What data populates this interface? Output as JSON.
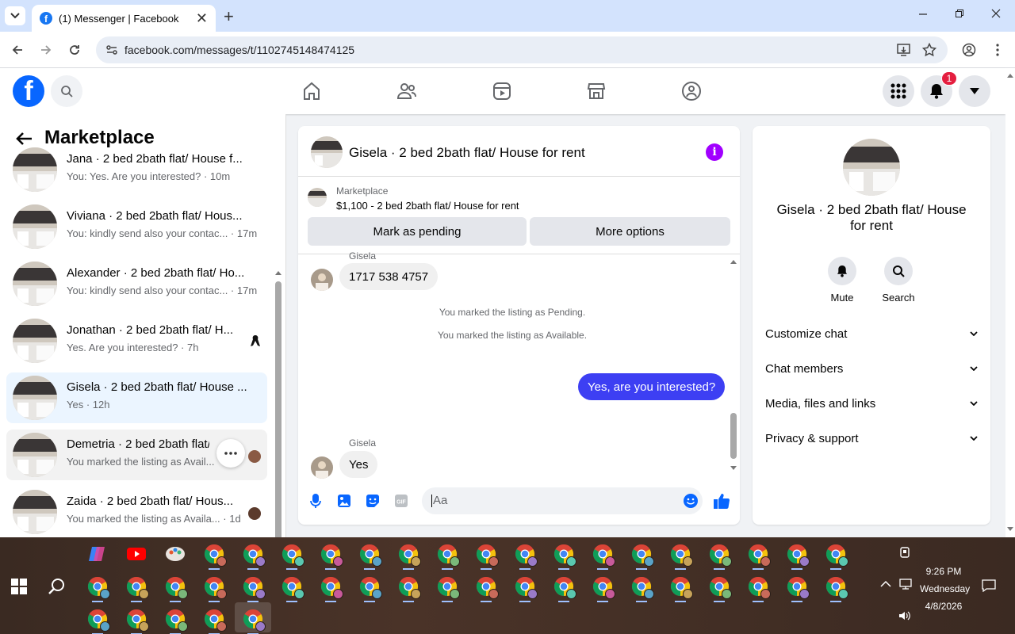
{
  "browser": {
    "tab_title": "(1) Messenger | Facebook",
    "url": "facebook.com/messages/t/1102745148474125",
    "new_tab": "+",
    "close_tab": "✕"
  },
  "fb": {
    "logo_letter": "f",
    "notification_count": "1",
    "nav_icons": [
      "home-icon",
      "friends-icon",
      "video-icon",
      "marketplace-icon",
      "groups-icon"
    ]
  },
  "sidebar": {
    "title": "Marketplace",
    "conversations": [
      {
        "name": "Jana · 2 bed 2bath flat/ House f...",
        "snippet": "You: Yes. Are you interested? · 10m"
      },
      {
        "name": "Viviana · 2 bed 2bath flat/ Hous...",
        "snippet": "You: kindly send also your contac... · 17m"
      },
      {
        "name": "Alexander · 2 bed 2bath flat/ Ho...",
        "snippet": "You: kindly send also your contac... · 17m"
      },
      {
        "name": "Jonathan · 2 bed 2bath flat/ H...",
        "snippet": "Yes. Are you interested? · 7h"
      },
      {
        "name": "Gisela · 2 bed 2bath flat/ House ...",
        "snippet": "Yes · 12h"
      },
      {
        "name": "Demetria · 2 bed 2bath flat/ H...",
        "snippet": "You marked the listing as Avail..."
      },
      {
        "name": "Zaida · 2 bed 2bath flat/ Hous...",
        "snippet": "You marked the listing as Availa... · 1d"
      }
    ]
  },
  "chat": {
    "title": "Gisela · 2 bed 2bath flat/ House for rent",
    "listing_label": "Marketplace",
    "listing_price": "$1,100 - 2 bed 2bath flat/ House for rent",
    "mark_pending": "Mark as pending",
    "more_options": "More options",
    "messages": {
      "sender_top": "Gisela",
      "phone": "1717 538 4757",
      "sys1": "You marked the listing as Pending.",
      "sys2": "You marked the listing as Available.",
      "out1": "Yes, are you interested?",
      "sender_bottom": "Gisela",
      "in_last": "Yes"
    },
    "composer_placeholder": "Aa"
  },
  "details": {
    "name": "Gisela · 2 bed 2bath flat/ House for rent",
    "mute": "Mute",
    "search": "Search",
    "sections": [
      "Customize chat",
      "Chat members",
      "Media, files and links",
      "Privacy & support"
    ]
  },
  "taskbar": {
    "time": "9:26 PM",
    "day": "Wednesday",
    "date": "4/8/2026"
  },
  "colors": {
    "fb_blue": "#0866ff",
    "outgoing_bubble": "#3d3ff3",
    "info_purple": "#a100ff",
    "active_convo": "#ebf5ff",
    "badge_red": "#e41e3f"
  }
}
